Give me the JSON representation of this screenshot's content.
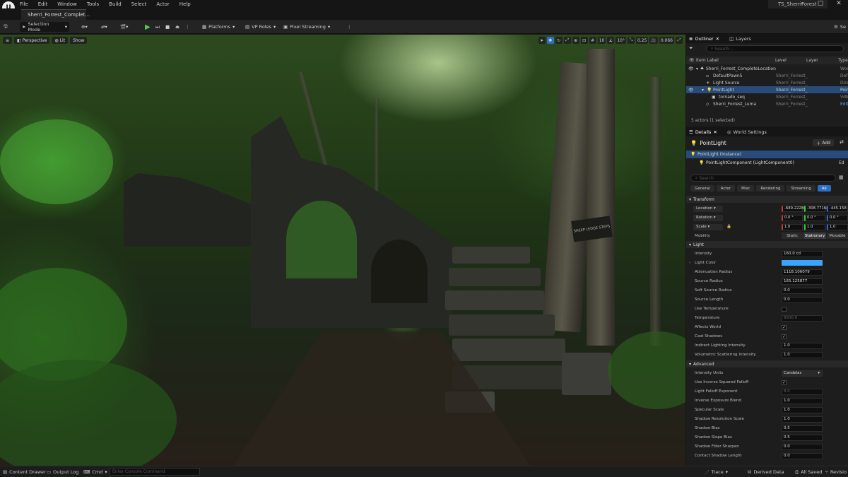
{
  "menubar": {
    "logo": "U",
    "items": [
      "File",
      "Edit",
      "Window",
      "Tools",
      "Build",
      "Select",
      "Actor",
      "Help"
    ],
    "project_name": "TS_SherriForest"
  },
  "tabs": {
    "level_tab": "Sherri_Forrest_Complet..."
  },
  "toolbar": {
    "selection_mode": "Selection Mode",
    "platforms": "Platforms",
    "vp_roles": "VP Roles",
    "pixel_streaming": "Pixel Streaming",
    "settings": "Se"
  },
  "viewport": {
    "perspective": "Perspective",
    "lit": "Lit",
    "show": "Show",
    "grid_snap": "10",
    "rot_snap": "10°",
    "scale_snap": "0.25",
    "cam_speed": "0.066",
    "sign_text": "SHEEP LEDGE STEPS"
  },
  "statusbar": {
    "content_drawer": "Content Drawer",
    "output_log": "Output Log",
    "cmd": "Cmd",
    "console_placeholder": "Enter Console Command",
    "trace": "Trace",
    "derived_data": "Derived Data",
    "all_saved": "All Saved",
    "revision": "Revisio"
  },
  "outliner": {
    "tab_outliner": "Outliner",
    "tab_layers": "Layers",
    "search_placeholder": "Search...",
    "col_item": "Item Label",
    "col_level": "Level",
    "col_layer": "Layer",
    "col_type": "Type",
    "rows": [
      {
        "label": "Sherri_Forrest_CompleteLocation",
        "level": "",
        "type": "Wor"
      },
      {
        "label": "DefaultPawn5",
        "level": "Sherri_Forrest_",
        "type": "Defa"
      },
      {
        "label": "Light Source",
        "level": "Sherri_Forrest_",
        "type": "Direc"
      },
      {
        "label": "PointLight",
        "level": "Sherri_Forrest_",
        "type": "Poin"
      },
      {
        "label": "tornado_seq",
        "level": "Sherri_Forrest_",
        "type": "Vdb"
      },
      {
        "label": "Sherri_Forrest_Luma",
        "level": "Sherri_Forrest_",
        "type": "Edit"
      }
    ],
    "count": "5 actors (1 selected)"
  },
  "details": {
    "tab_details": "Details",
    "tab_world": "World Settings",
    "actor_name": "PointLight",
    "add_label": "Add",
    "instance": "PointLight (Instance)",
    "component": "PointLightComponent (LightComponent0)",
    "component_edit": "Ed",
    "search_placeholder": "Search",
    "filters": [
      "General",
      "Actor",
      "Misc",
      "Rendering",
      "Streaming",
      "All"
    ],
    "transform": {
      "section": "Transform",
      "location_label": "Location",
      "location": [
        "-689.2228(",
        "-308.7716(",
        "-445.158"
      ],
      "rotation_label": "Rotation",
      "rotation": [
        "0.0 °",
        "0.0 °",
        "0.0 °"
      ],
      "scale_label": "Scale",
      "scale": [
        "1.0",
        "1.0",
        "1.0"
      ],
      "mobility_label": "Mobility",
      "mobility": [
        "Static",
        "Stationary",
        "Movable"
      ]
    },
    "light": {
      "section": "Light",
      "intensity_label": "Intensity",
      "intensity": "160.0 cd",
      "light_color_label": "Light Color",
      "light_color": "#3ca3ff",
      "attenuation_label": "Attenuation Radius",
      "attenuation": "1118.106079",
      "source_radius_label": "Source Radius",
      "source_radius": "165.125877",
      "soft_source_label": "Soft Source Radius",
      "soft_source": "0.0",
      "source_length_label": "Source Length",
      "source_length": "0.0",
      "use_temp_label": "Use Temperature",
      "temperature_label": "Temperature",
      "temperature": "6500.0",
      "affects_world_label": "Affects World",
      "cast_shadows_label": "Cast Shadows",
      "indirect_label": "Indirect Lighting Intensity",
      "indirect": "1.0",
      "volumetric_label": "Volumetric Scattering Intensity",
      "volumetric": "1.0"
    },
    "advanced": {
      "section": "Advanced",
      "intensity_units_label": "Intensity Units",
      "intensity_units": "Candelas",
      "inverse_sq_label": "Use Inverse Squared Falloff",
      "falloff_exp_label": "Light Falloff Exponent",
      "falloff_exp": "8.0",
      "inv_exposure_label": "Inverse Exposure Blend",
      "inv_exposure": "1.0",
      "specular_label": "Specular Scale",
      "specular": "1.0",
      "shadow_res_label": "Shadow Resolution Scale",
      "shadow_res": "1.0",
      "shadow_bias_label": "Shadow Bias",
      "shadow_bias": "0.5",
      "shadow_slope_label": "Shadow Slope Bias",
      "shadow_slope": "0.5",
      "shadow_filter_label": "Shadow Filter Sharpen",
      "shadow_filter": "0.0",
      "contact_shadow_label": "Contact Shadow Length",
      "contact_shadow": "0.0"
    }
  }
}
